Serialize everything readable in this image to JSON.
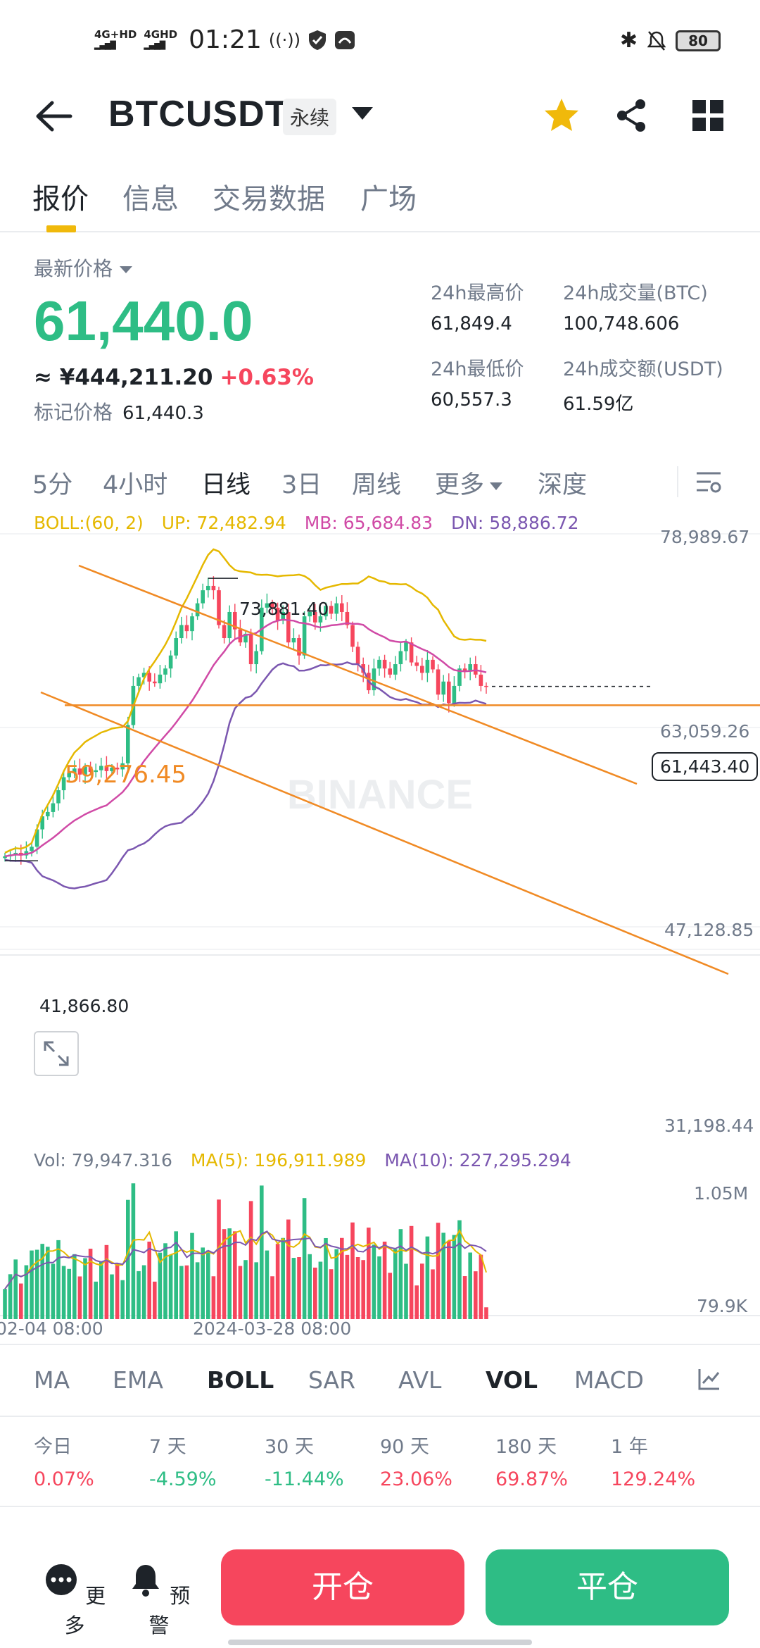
{
  "status_bar": {
    "net1": "4G+HD",
    "net2": "4GHD",
    "time": "01:21",
    "battery": "80"
  },
  "header": {
    "symbol": "BTCUSDT",
    "badge": "永续"
  },
  "tabs": [
    "报价",
    "信息",
    "交易数据",
    "广场"
  ],
  "price": {
    "last_label": "最新价格",
    "last_price": "61,440.0",
    "cny": "≈ ¥444,211.20",
    "change": "+0.63%",
    "mark_label": "标记价格",
    "mark_value": "61,440.3",
    "high_label": "24h最高价",
    "high_value": "61,849.4",
    "low_label": "24h最低价",
    "low_value": "60,557.3",
    "vol_btc_label": "24h成交量(BTC)",
    "vol_btc_value": "100,748.606",
    "vol_usdt_label": "24h成交额(USDT)",
    "vol_usdt_value": "61.59亿"
  },
  "intervals": [
    "5分",
    "4小时",
    "日线",
    "3日",
    "周线",
    "更多",
    "深度"
  ],
  "colors": {
    "up": "#2ebd85",
    "down": "#f6465d",
    "boll_up": "#e5b800",
    "boll_mb": "#d04aa6",
    "boll_dn": "#7b57b0",
    "trendline": "#f08a24",
    "accent": "#f0b90b"
  },
  "chart": {
    "boll_legend": {
      "label": "BOLL:(60, 2)",
      "up": "UP: 72,482.94",
      "mb": "MB: 65,684.83",
      "dn": "DN: 58,886.72"
    },
    "y_labels": [
      "78,989.67",
      "63,059.26",
      "47,128.85",
      "31,198.44"
    ],
    "high_annotation": "73,881.40",
    "low_annotation": "41,866.80",
    "level_annotation": "59,276.45",
    "current_price_tag": "61,443.40",
    "watermark": "BINANCE",
    "vol_legend": {
      "vol": "Vol: 79,947.316",
      "ma5": "MA(5): 196,911.989",
      "ma10": "MA(10): 227,295.294"
    },
    "vol_y_labels": [
      "1.05M",
      "79.9K"
    ],
    "x_labels": [
      "02-04 08:00",
      "2024-03-28 08:00"
    ]
  },
  "chart_data": {
    "type": "candlestick",
    "y_range": [
      31198.44,
      78989.67
    ],
    "y_ticks": [
      78989.67,
      63059.26,
      47128.85,
      31198.44
    ],
    "x_ticks": [
      "02-04 08:00",
      "2024-03-28 08:00"
    ],
    "period_high": 73881.4,
    "period_low": 41866.8,
    "last_price": 61443.4,
    "horizontal_level": 59276.45,
    "boll": {
      "up": 72482.94,
      "mb": 65684.83,
      "dn": 58886.72
    },
    "closes": [
      41900,
      42100,
      42300,
      42000,
      42500,
      43000,
      45000,
      46500,
      47000,
      48000,
      49500,
      51000,
      51500,
      52000,
      51300,
      52200,
      51600,
      51800,
      52300,
      51700,
      52100,
      51900,
      52600,
      57000,
      61500,
      62500,
      63000,
      62000,
      61800,
      62800,
      63500,
      65000,
      67000,
      68500,
      67800,
      69500,
      71000,
      72500,
      73000,
      72500,
      68500,
      67000,
      70000,
      68000,
      66500,
      67500,
      64000,
      65500,
      70500,
      71000,
      70500,
      69000,
      70000,
      66500,
      67000,
      65000,
      69500,
      70000,
      68800,
      69500,
      70700,
      69800,
      71000,
      70000,
      68500,
      66000,
      64000,
      63000,
      61000,
      63500,
      64500,
      63500,
      62800,
      64000,
      65500,
      66500,
      64200,
      63800,
      63000,
      64500,
      63400,
      60500,
      62000,
      59500,
      61500,
      63500,
      63200,
      64000,
      62800,
      61500,
      61444
    ],
    "volume_range": [
      0,
      1050000
    ],
    "volume_last": 79947.316,
    "vol_ma5": 196911.989,
    "vol_ma10": 227295.294
  },
  "indicators": [
    "MA",
    "EMA",
    "BOLL",
    "SAR",
    "AVL",
    "VOL",
    "MACD"
  ],
  "performance": [
    {
      "k": "今日",
      "v": "0.07%",
      "dir": "down"
    },
    {
      "k": "7 天",
      "v": "-4.59%",
      "dir": "up"
    },
    {
      "k": "30 天",
      "v": "-11.44%",
      "dir": "up"
    },
    {
      "k": "90 天",
      "v": "23.06%",
      "dir": "down"
    },
    {
      "k": "180 天",
      "v": "69.87%",
      "dir": "down"
    },
    {
      "k": "1 年",
      "v": "129.24%",
      "dir": "down"
    }
  ],
  "bottom": {
    "more": "更多",
    "alert": "预警",
    "open": "开仓",
    "close": "平仓"
  }
}
